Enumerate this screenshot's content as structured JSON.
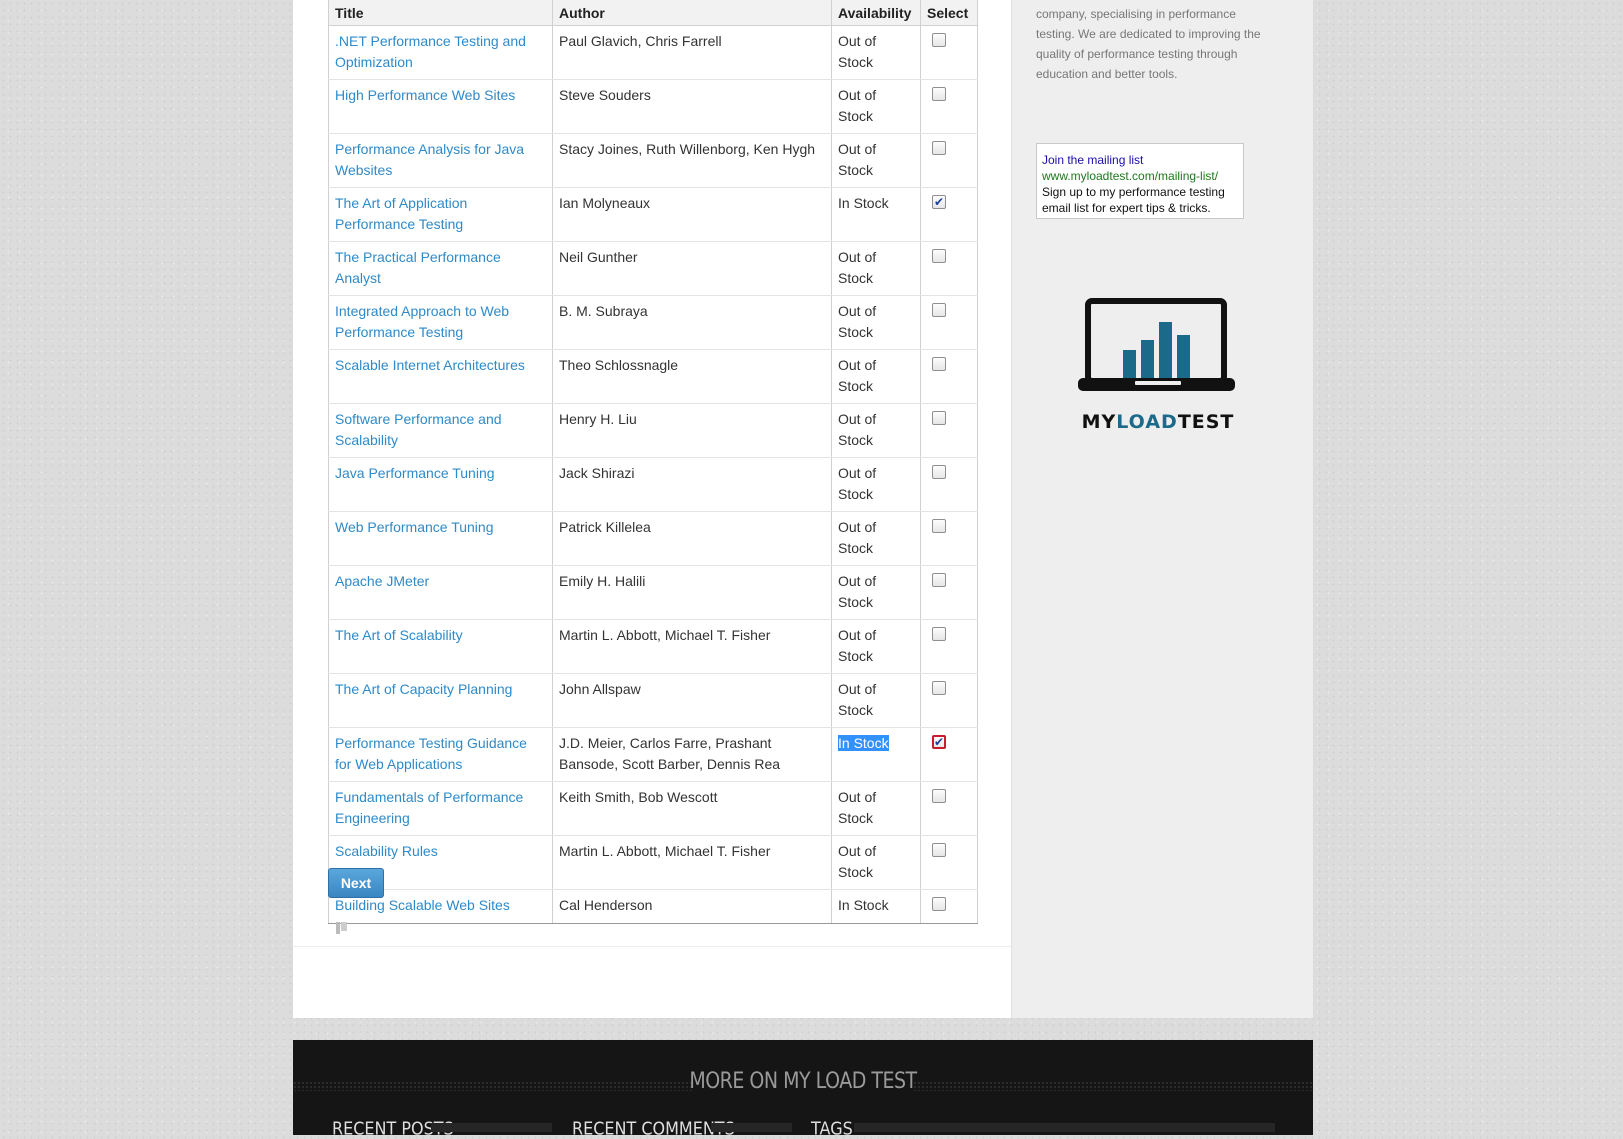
{
  "table": {
    "headers": {
      "title": "Title",
      "author": "Author",
      "availability": "Availability",
      "select": "Select"
    },
    "rows": [
      {
        "title": ".NET Performance Testing and Optimization",
        "author": "Paul Glavich, Chris Farrell",
        "availability": "Out of Stock",
        "checked": false
      },
      {
        "title": "High Performance Web Sites",
        "author": "Steve Souders",
        "availability": "Out of Stock",
        "checked": false
      },
      {
        "title": "Performance Analysis for Java Websites",
        "author": "Stacy Joines, Ruth Willenborg, Ken Hygh",
        "availability": "Out of Stock",
        "checked": false
      },
      {
        "title": "The Art of Application Performance Testing",
        "author": "Ian Molyneaux",
        "availability": "In Stock",
        "checked": true
      },
      {
        "title": "The Practical Performance Analyst",
        "author": "Neil Gunther",
        "availability": "Out of Stock",
        "checked": false
      },
      {
        "title": "Integrated Approach to Web Performance Testing",
        "author": "B. M. Subraya",
        "availability": "Out of Stock",
        "checked": false
      },
      {
        "title": "Scalable Internet Architectures",
        "author": "Theo Schlossnagle",
        "availability": "Out of Stock",
        "checked": false
      },
      {
        "title": "Software Performance and Scalability",
        "author": "Henry H. Liu",
        "availability": "Out of Stock",
        "checked": false
      },
      {
        "title": "Java Performance Tuning",
        "author": "Jack Shirazi",
        "availability": "Out of Stock",
        "checked": false
      },
      {
        "title": "Web Performance Tuning",
        "author": "Patrick Killelea",
        "availability": "Out of Stock",
        "checked": false
      },
      {
        "title": "Apache JMeter",
        "author": "Emily H. Halili",
        "availability": "Out of Stock",
        "checked": false
      },
      {
        "title": "The Art of Scalability",
        "author": "Martin L. Abbott, Michael T. Fisher",
        "availability": "Out of Stock",
        "checked": false
      },
      {
        "title": "The Art of Capacity Planning",
        "author": "John Allspaw",
        "availability": "Out of Stock",
        "checked": false
      },
      {
        "title": "Performance Testing Guidance for Web Applications",
        "author": "J.D. Meier, Carlos Farre, Prashant Bansode, Scott Barber, Dennis Rea",
        "availability": "In Stock",
        "checked": true,
        "selected": true
      },
      {
        "title": "Fundamentals of Performance Engineering",
        "author": "Keith Smith, Bob Wescott",
        "availability": "Out of Stock",
        "checked": false
      },
      {
        "title": "Scalability Rules",
        "author": "Martin L. Abbott, Michael T. Fisher",
        "availability": "Out of Stock",
        "checked": false
      },
      {
        "title": "Building Scalable Web Sites",
        "author": "Cal Henderson",
        "availability": "In Stock",
        "checked": false
      }
    ]
  },
  "next_button": "Next",
  "sidebar": {
    "about_text": "company, specialising in performance testing. We are dedicated to improving the quality of performance testing through education and better tools.",
    "mailing": {
      "title": "Join the mailing list",
      "url": "www.myloadtest.com/mailing-list/",
      "description": "Sign up to my performance testing email list for expert tips & tricks."
    },
    "logo": {
      "part1": "MY",
      "part2": "LOAD",
      "part3": "TEST"
    }
  },
  "footer": {
    "title": "MORE ON MY LOAD TEST",
    "columns": [
      "RECENT POSTS",
      "RECENT COMMENTS",
      "TAGS"
    ]
  },
  "colors": {
    "link": "#2e8ac9",
    "accent_logo": "#1b6a8a",
    "button": "#3a86c2",
    "selection": "#3390ff"
  }
}
